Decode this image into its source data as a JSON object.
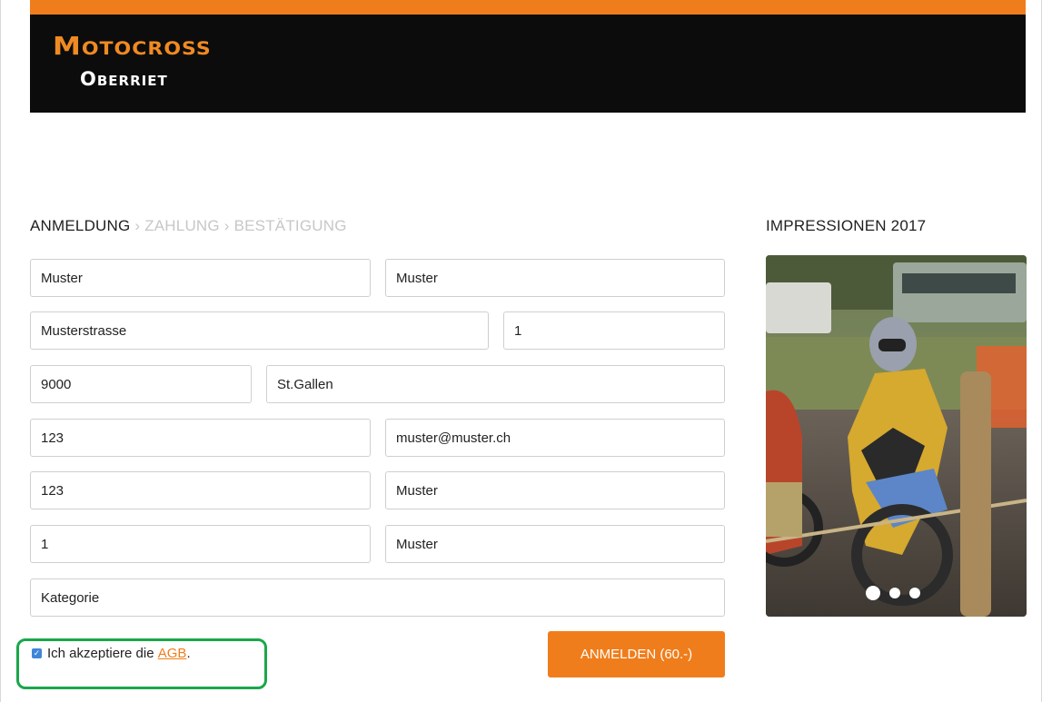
{
  "brand": {
    "title": "Motocross",
    "subtitle": "Oberriet",
    "colors": {
      "accent": "#f07d1b",
      "header_bg": "#0c0c0c",
      "highlight_outline": "#1aa74a",
      "checkbox": "#3f86d8"
    }
  },
  "steps": {
    "active": "ANMELDUNG",
    "separator": "›",
    "payment": "ZAHLUNG",
    "confirmation": "BESTÄTIGUNG"
  },
  "form": {
    "lastname": "Muster",
    "firstname": "Muster",
    "street": "Musterstrasse",
    "house_no": "1",
    "zip": "9000",
    "city": "St.Gallen",
    "phone": "123",
    "email": "muster@muster.ch",
    "field_7": "123",
    "field_8": "Muster",
    "field_9": "1",
    "field_10": "Muster",
    "category": "Kategorie",
    "agb_prefix": "Ich akzeptiere die",
    "agb_link": "AGB",
    "agb_suffix": ".",
    "agb_checked": true,
    "submit": "ANMELDEN (60.-)"
  },
  "sidebar": {
    "title": "IMPRESSIONEN 2017",
    "carousel": {
      "slides": 3,
      "active_index": 0
    }
  }
}
